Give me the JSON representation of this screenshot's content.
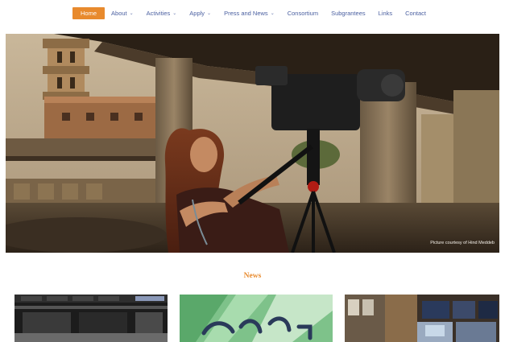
{
  "nav": {
    "items": [
      {
        "label": "Home",
        "active": true,
        "dropdown": false
      },
      {
        "label": "About",
        "active": false,
        "dropdown": true
      },
      {
        "label": "Activities",
        "active": false,
        "dropdown": true
      },
      {
        "label": "Apply",
        "active": false,
        "dropdown": true
      },
      {
        "label": "Press and News",
        "active": false,
        "dropdown": true
      },
      {
        "label": "Consortium",
        "active": false,
        "dropdown": false
      },
      {
        "label": "Subgrantees",
        "active": false,
        "dropdown": false
      },
      {
        "label": "Links",
        "active": false,
        "dropdown": false
      },
      {
        "label": "Contact",
        "active": false,
        "dropdown": false
      }
    ],
    "dropdown_icon": "chevron-down-icon"
  },
  "hero": {
    "caption": "Picture courtesy of Hind Meddeb"
  },
  "news": {
    "heading": "News"
  },
  "colors": {
    "accent": "#e88a2d",
    "nav_text": "#4a5fa0"
  }
}
